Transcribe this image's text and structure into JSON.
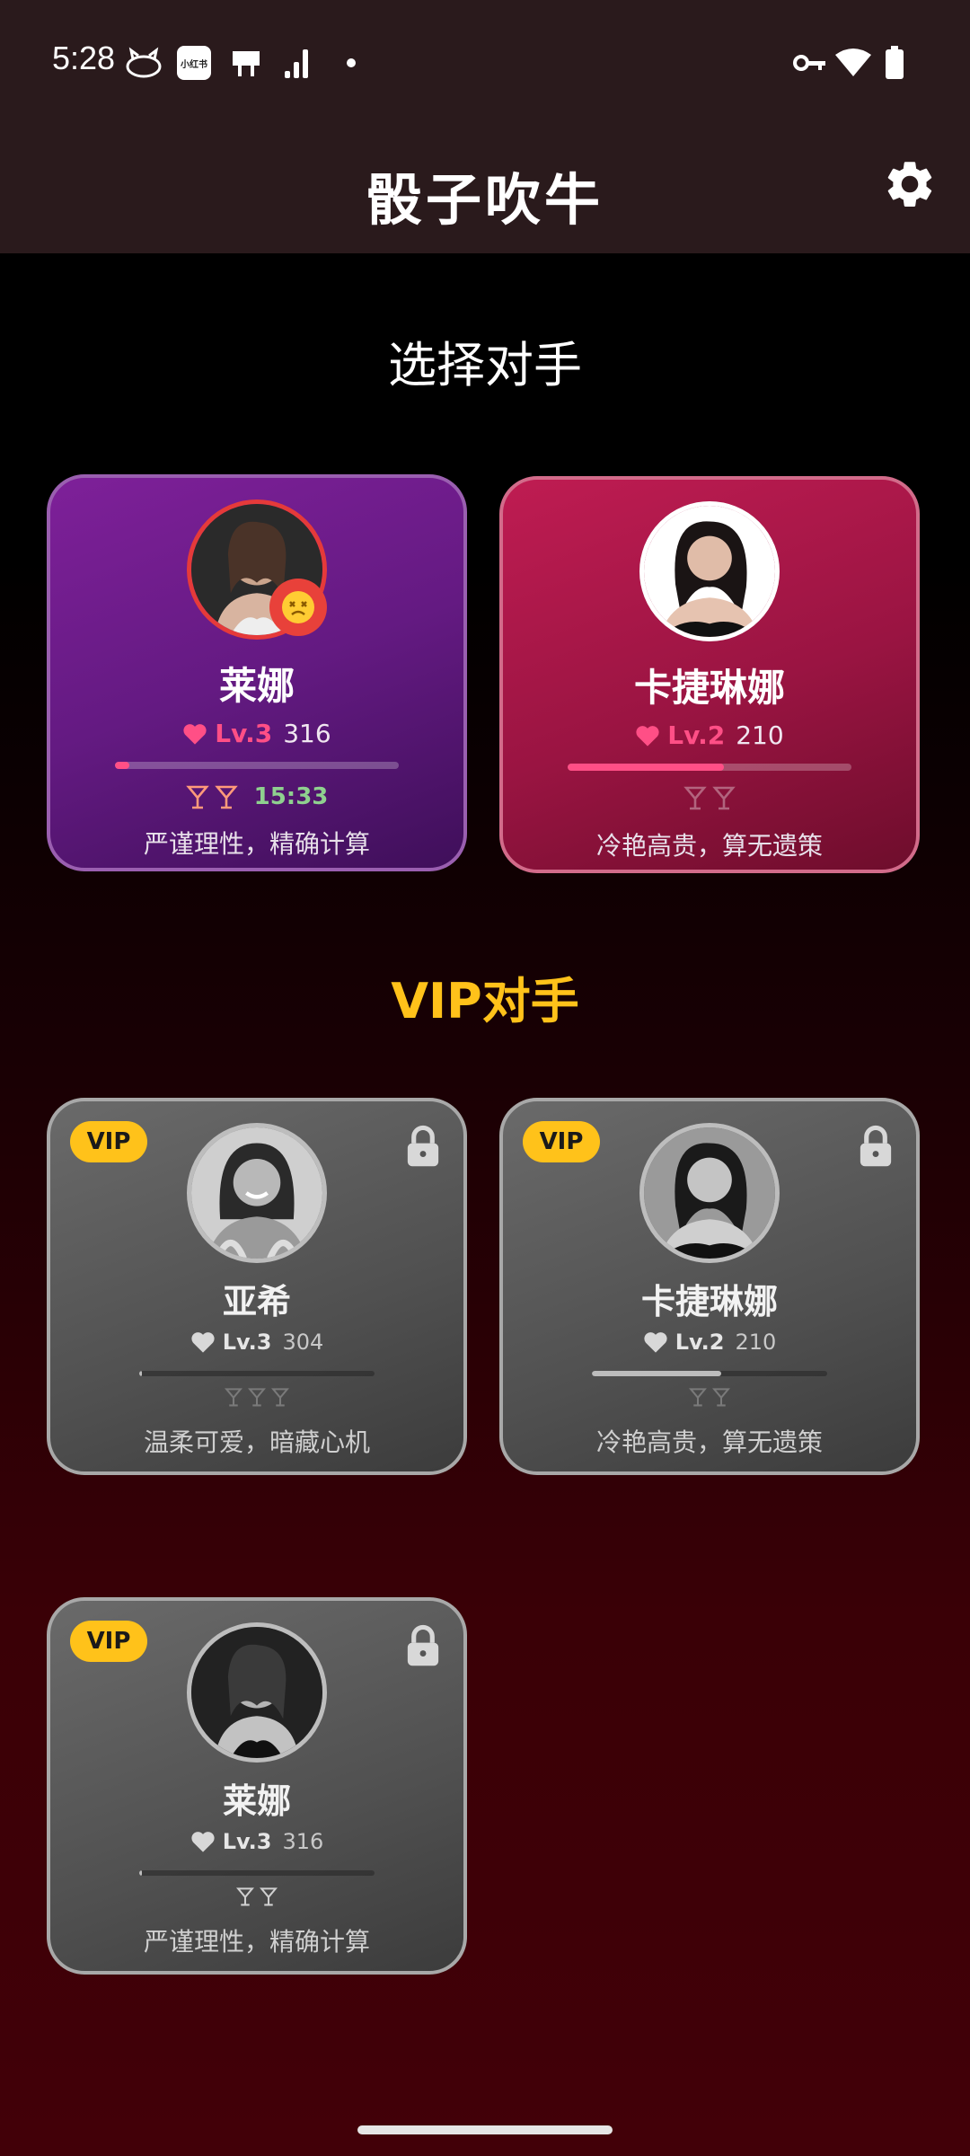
{
  "status_bar": {
    "time": "5:28",
    "icons": [
      "notification-cat-icon",
      "app-badge-icon",
      "cast-icon",
      "signal-icon",
      "dot-icon",
      "vpn-key-icon",
      "wifi-icon",
      "battery-icon"
    ],
    "app_badge_text": "小红书"
  },
  "app_bar": {
    "title": "骰子吹牛",
    "settings_icon": "gear-icon"
  },
  "sections": {
    "opponents_title": "选择对手",
    "vip_title": "VIP对手"
  },
  "opponents": [
    {
      "name": "莱娜",
      "level": "Lv.3",
      "points": "316",
      "progress": 0.05,
      "drinks": 2,
      "timer": "15:33",
      "description": "严谨理性，精确计算",
      "theme": "purple",
      "active": true,
      "mood_icon": "dizzy-face-icon"
    },
    {
      "name": "卡捷琳娜",
      "level": "Lv.2",
      "points": "210",
      "progress": 0.55,
      "drinks": 2,
      "timer": "",
      "description": "冷艳高贵，算无遗策",
      "theme": "pink",
      "active": false
    }
  ],
  "vip_opponents": [
    {
      "badge": "VIP",
      "name": "亚希",
      "level": "Lv.3",
      "points": "304",
      "progress": 0.01,
      "drinks": 3,
      "description": "温柔可爱，暗藏心机",
      "locked": true
    },
    {
      "badge": "VIP",
      "name": "卡捷琳娜",
      "level": "Lv.2",
      "points": "210",
      "progress": 0.55,
      "drinks": 2,
      "description": "冷艳高贵，算无遗策",
      "locked": true
    },
    {
      "badge": "VIP",
      "name": "莱娜",
      "level": "Lv.3",
      "points": "316",
      "progress": 0.01,
      "drinks": 2,
      "description": "严谨理性，精确计算",
      "locked": true
    }
  ],
  "colors": {
    "vip_gold": "#ffc21a",
    "level_pink": "#ff4f86",
    "timer_green": "#8fd08f",
    "active_border": "#e53a3a"
  }
}
